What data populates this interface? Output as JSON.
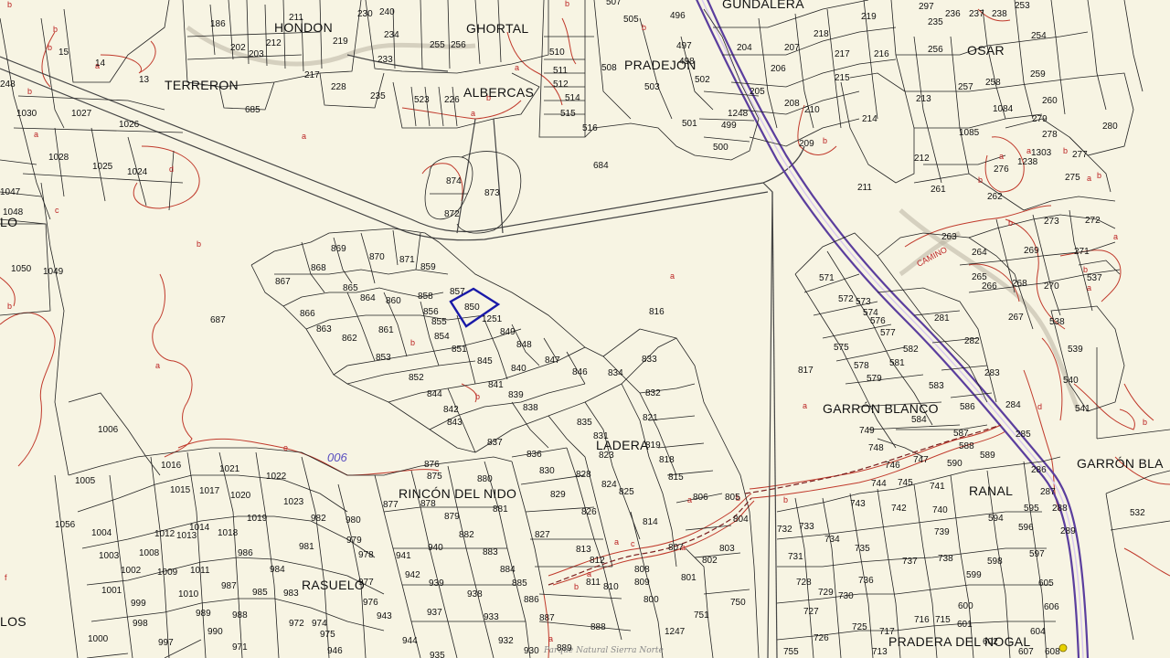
{
  "place_names": {
    "hondon": "HONDON",
    "ghortal": "GHORTAL",
    "gundalera": "GUNDALERA",
    "osar": "OSAR",
    "terreron": "TERRERON",
    "pradejon": "PRADEJON",
    "albercas": "ALBERCAS",
    "garron_blanco": "GARRÓN BLANCO",
    "garron_bla": "GARRÓN BLA",
    "ladera": "LADERA",
    "rincon_del_nido": "RINCÓN DEL NIDO",
    "ranal": "RANAL",
    "rasuelo": "RASUELO",
    "pradera_del_nogal": "PRADERA DEL NOGAL",
    "lo": "LO",
    "los": "LOS"
  },
  "road_labels": {
    "camino": "CAMINO"
  },
  "sector_label": "006",
  "watermark": "Parque Natural Sierra Norte",
  "selected_parcel": "850",
  "parcel_numbers": {
    "p186": "186",
    "p202": "202",
    "p203": "203",
    "p211": "211",
    "p212": "212",
    "p219": "219",
    "p230": "230",
    "p240": "240",
    "p234": "234",
    "p233": "233",
    "p255": "255",
    "p256": "256",
    "p217": "217",
    "p228": "228",
    "p235": "235",
    "p228b": "228",
    "p226": "226",
    "p523": "523",
    "p510": "510",
    "p511": "511",
    "p512": "512",
    "p514": "514",
    "p515": "515",
    "p516": "516",
    "p507": "507",
    "p505": "505",
    "p508": "508",
    "p496": "496",
    "p497": "497",
    "p498": "498",
    "p503": "503",
    "p502": "502",
    "p501": "501",
    "p499": "499",
    "p500": "500",
    "p1248": "1248",
    "p684": "684",
    "p685": "685",
    "p14": "14",
    "p13": "13",
    "p15": "15",
    "p248": "248",
    "p1030": "1030",
    "p1027": "1027",
    "p1026": "1026",
    "p1028": "1028",
    "p1025": "1025",
    "p1024": "1024",
    "p1047": "1047",
    "p1048": "1048",
    "p1050": "1050",
    "p1049": "1049",
    "p687": "687",
    "p874": "874",
    "p873": "873",
    "p872": "872",
    "p204": "204",
    "p207": "207",
    "p218": "218",
    "p206": "206",
    "p205": "205",
    "p217b": "217",
    "p216": "216",
    "p219b": "219",
    "p215": "215",
    "p208": "208",
    "p210": "210",
    "p209": "209",
    "p214": "214",
    "p213": "213",
    "p212b": "212",
    "p211b": "211",
    "p261": "261",
    "p262": "262",
    "p257": "257",
    "p258": "258",
    "p259": "259",
    "p254": "254",
    "p1084": "1084",
    "p260": "260",
    "p279": "279",
    "p280": "280",
    "p278": "278",
    "p1085": "1085",
    "p277": "277",
    "p276": "276",
    "p275": "275",
    "p1303": "1303",
    "p1238": "1238",
    "p297": "297",
    "p235b": "235",
    "p236": "236",
    "p237": "237",
    "p238": "238",
    "p253": "253",
    "p256b": "256",
    "p273": "273",
    "p272": "272",
    "p263": "263",
    "p264": "264",
    "p269": "269",
    "p271": "271",
    "p265": "265",
    "p266": "266",
    "p268": "268",
    "p270": "270",
    "p267": "267",
    "p537": "537",
    "p538": "538",
    "p539": "539",
    "p540": "540",
    "p541": "541",
    "p869": "869",
    "p870": "870",
    "p871": "871",
    "p868": "868",
    "p859": "859",
    "p867": "867",
    "p865": "865",
    "p864": "864",
    "p860": "860",
    "p858": "858",
    "p857": "857",
    "p850": "850",
    "p866": "866",
    "p856": "856",
    "p863": "863",
    "p855": "855",
    "p1251": "1251",
    "p862": "862",
    "p861": "861",
    "p854": "854",
    "p849": "849",
    "p851": "851",
    "p848": "848",
    "p853": "853",
    "p845": "845",
    "p847": "847",
    "p840": "840",
    "p846": "846",
    "p834": "834",
    "p833": "833",
    "p816": "816",
    "p852": "852",
    "p841": "841",
    "p844": "844",
    "p839": "839",
    "p842": "842",
    "p838": "838",
    "p832": "832",
    "p843": "843",
    "p835": "835",
    "p831": "831",
    "p821": "821",
    "p837": "837",
    "p823": "823",
    "p819": "819",
    "p836": "836",
    "p818": "818",
    "p830": "830",
    "p828": "828",
    "p815": "815",
    "p824": "824",
    "p825": "825",
    "p806": "806",
    "p805": "805",
    "p829": "829",
    "p826": "826",
    "p804": "804",
    "p814": "814",
    "p827": "827",
    "p813": "813",
    "p812": "812",
    "p807": "807",
    "p803": "803",
    "p802": "802",
    "p811": "811",
    "p810": "810",
    "p808": "808",
    "p801": "801",
    "p809": "809",
    "p800": "800",
    "p750": "750",
    "p751": "751",
    "p888": "888",
    "p1247": "1247",
    "p571": "571",
    "p572": "572",
    "p573": "573",
    "p574": "574",
    "p576": "576",
    "p281": "281",
    "p577": "577",
    "p575": "575",
    "p582": "582",
    "p282": "282",
    "p578": "578",
    "p581": "581",
    "p817": "817",
    "p579": "579",
    "p283": "283",
    "p583": "583",
    "p586": "586",
    "p584": "584",
    "p284": "284",
    "p749": "749",
    "p587": "587",
    "p285": "285",
    "p748": "748",
    "p746": "746",
    "p747": "747",
    "p588": "588",
    "p589": "589",
    "p590": "590",
    "p286": "286",
    "p744": "744",
    "p745": "745",
    "p741": "741",
    "p287": "287",
    "p743": "743",
    "p742": "742",
    "p740": "740",
    "p595": "595",
    "p288": "288",
    "p594": "594",
    "p596": "596",
    "p289": "289",
    "p739": "739",
    "p732": "732",
    "p733": "733",
    "p734": "734",
    "p735": "735",
    "p597": "597",
    "p731": "731",
    "p737": "737",
    "p738": "738",
    "p598": "598",
    "p532": "532",
    "p728": "728",
    "p736": "736",
    "p599": "599",
    "p605": "605",
    "p727": "727",
    "p729": "729",
    "p730": "730",
    "p600": "600",
    "p606": "606",
    "p726": "726",
    "p725": "725",
    "p717": "717",
    "p716": "716",
    "p715": "715",
    "p601": "601",
    "p604": "604",
    "p755": "755",
    "p713": "713",
    "p607": "607",
    "p608": "608",
    "p602": "602",
    "p1006": "1006",
    "p1016": "1016",
    "p1021": "1021",
    "p1022": "1022",
    "p1005": "1005",
    "p1015": "1015",
    "p1017": "1017",
    "p1020": "1020",
    "p1023": "1023",
    "p1056": "1056",
    "p1004": "1004",
    "p1012": "1012",
    "p1013": "1013",
    "p1014": "1014",
    "p1018": "1018",
    "p1019": "1019",
    "p982": "982",
    "p1003": "1003",
    "p1008": "1008",
    "p986": "986",
    "p980": "980",
    "p979": "979",
    "p1002": "1002",
    "p1009": "1009",
    "p1011": "1011",
    "p984": "984",
    "p981": "981",
    "p978": "978",
    "p1001": "1001",
    "p987": "987",
    "p985": "985",
    "p983": "983",
    "p977": "977",
    "p999": "999",
    "p1010": "1010",
    "p976": "976",
    "p998": "998",
    "p989": "989",
    "p988": "988",
    "p972": "972",
    "p974": "974",
    "p1000": "1000",
    "p990": "990",
    "p975": "975",
    "p997": "997",
    "p971": "971",
    "p946": "946",
    "p876": "876",
    "p875": "875",
    "p877": "877",
    "p880": "880",
    "p881": "881",
    "p878": "878",
    "p879": "879",
    "p882": "882",
    "p941": "941",
    "p940": "940",
    "p883": "883",
    "p942": "942",
    "p884": "884",
    "p939": "939",
    "p885": "885",
    "p938": "938",
    "p943": "943",
    "p937": "937",
    "p886": "886",
    "p933": "933",
    "p887": "887",
    "p944": "944",
    "p932": "932",
    "p930": "930",
    "p889": "889",
    "p935": "935"
  }
}
